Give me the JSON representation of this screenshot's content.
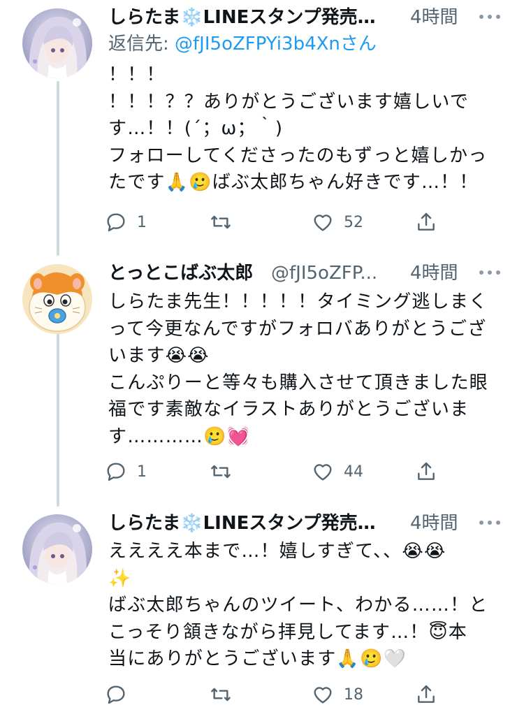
{
  "thread": [
    {
      "avatar": "anime-girl-avatar",
      "name": "しらたま❄️LINEスタンプ発売…",
      "handle": "",
      "time": "4時間",
      "reply_to_prefix": "返信先: ",
      "reply_to_handle": "@fJI5oZFPYi3b4Xnさん",
      "lines": [
        "！！！",
        "！！！？？ありがとうございます嬉しいで",
        "す…！！(´；ω；｀)",
        "フォローしてくださったのもずっと嬉しかっ",
        "たです🙏🥲ばぶ太郎ちゃん好きです…！！"
      ],
      "counts": {
        "reply": "1",
        "retweet": "",
        "like": "52"
      }
    },
    {
      "avatar": "hamster-with-pacifier-avatar",
      "name": "とっとこばぶ太郎",
      "handle": "@fJI5oZFP...",
      "time": "4時間",
      "reply_to_prefix": "",
      "reply_to_handle": "",
      "lines": [
        "しらたま先生！！！！！タイミング逃しまく",
        "って今更なんですがフォロバありがとうござ",
        "います😭😭",
        "こんぷりーと等々も購入させて頂きました眼",
        "福です素敵なイラストありがとうございま",
        "す…………🥲💓"
      ],
      "counts": {
        "reply": "1",
        "retweet": "",
        "like": "44"
      }
    },
    {
      "avatar": "anime-girl-avatar",
      "name": "しらたま❄️LINEスタンプ発売…",
      "handle": "",
      "time": "4時間",
      "reply_to_prefix": "",
      "reply_to_handle": "",
      "lines": [
        "ええええ本まで…！嬉しすぎて、、😭😭",
        "✨",
        "ばぶ太郎ちゃんのツイート、わかる……！と",
        "こっそり頷きながら拝見してます…！😇本",
        "当にありがとうございます🙏🥲🤍"
      ],
      "counts": {
        "reply": "",
        "retweet": "",
        "like": "18"
      }
    }
  ],
  "colors": {
    "text": "#0f1419",
    "secondary": "#536471",
    "link": "#1d9bf0",
    "thread_line": "#cfd9de"
  }
}
